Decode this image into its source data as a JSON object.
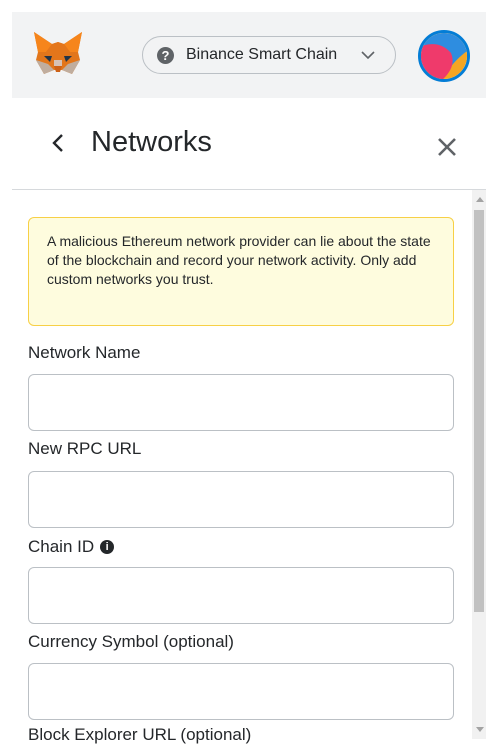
{
  "header": {
    "network_name": "Binance Smart Chain",
    "help_icon": "question-circle-icon",
    "dropdown_icon": "chevron-down-icon",
    "logo_icon": "metamask-fox-icon"
  },
  "page": {
    "title": "Networks",
    "back_icon": "chevron-left-icon",
    "close_icon": "close-icon"
  },
  "warning": {
    "text": "A malicious Ethereum network provider can lie about the state of the blockchain and record your network activity. Only add custom networks you trust."
  },
  "form": {
    "network_name": {
      "label": "Network Name",
      "value": ""
    },
    "rpc_url": {
      "label": "New RPC URL",
      "value": ""
    },
    "chain_id": {
      "label": "Chain ID",
      "info_icon": "info-icon",
      "value": ""
    },
    "currency_symbol": {
      "label": "Currency Symbol (optional)",
      "value": ""
    },
    "block_explorer": {
      "label": "Block Explorer URL (optional)"
    }
  },
  "colors": {
    "accent": "#037dd6",
    "warning_bg": "#fefcde",
    "warning_border": "#f7d046"
  }
}
